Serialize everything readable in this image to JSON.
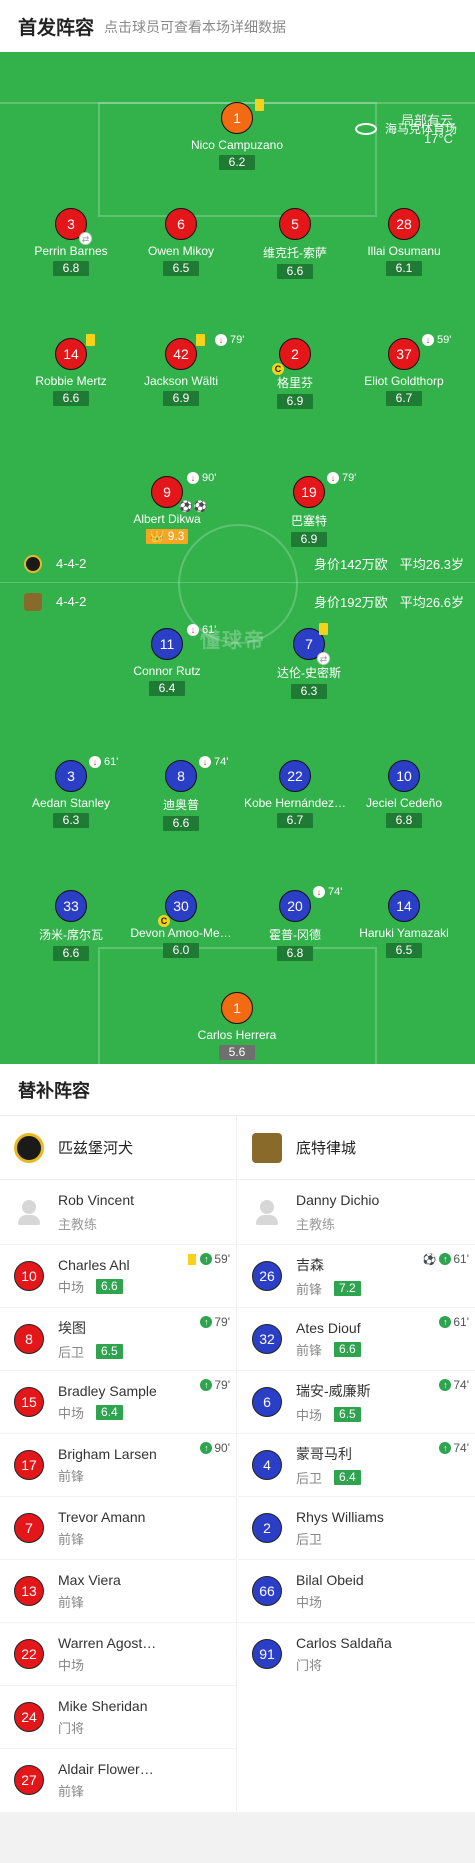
{
  "header": {
    "title": "首发阵容",
    "subtitle": "点击球员可查看本场详细数据"
  },
  "venue": {
    "name": "海马克体育场",
    "weather": "局部有云",
    "temp": "17°C"
  },
  "home_team": {
    "formation": "4-4-2",
    "value": "身价142万欧",
    "age": "平均26.3岁"
  },
  "away_team": {
    "formation": "4-4-2",
    "value": "身价192万欧",
    "age": "平均26.6岁"
  },
  "watermark": "懂球帝",
  "home_players": [
    {
      "num": "1",
      "name": "Nico Campuzano",
      "rating": "6.2"
    },
    {
      "num": "3",
      "name": "Perrin Barnes",
      "rating": "6.8"
    },
    {
      "num": "6",
      "name": "Owen Mikoy",
      "rating": "6.5"
    },
    {
      "num": "5",
      "name": "维克托-索萨",
      "rating": "6.6"
    },
    {
      "num": "28",
      "name": "Illai Osumanu",
      "rating": "6.1"
    },
    {
      "num": "14",
      "name": "Robbie Mertz",
      "rating": "6.6"
    },
    {
      "num": "42",
      "name": "Jackson Wälti",
      "rating": "6.9",
      "sub": "79'"
    },
    {
      "num": "2",
      "name": "格里芬",
      "rating": "6.9"
    },
    {
      "num": "37",
      "name": "Eliot Goldthorp",
      "rating": "6.7",
      "sub": "59'"
    },
    {
      "num": "9",
      "name": "Albert Dikwa",
      "rating": "9.3",
      "sub": "90'"
    },
    {
      "num": "19",
      "name": "巴塞特",
      "rating": "6.9",
      "sub": "79'"
    }
  ],
  "away_players": [
    {
      "num": "11",
      "name": "Connor Rutz",
      "rating": "6.4",
      "sub": "61'"
    },
    {
      "num": "7",
      "name": "达伦-史密斯",
      "rating": "6.3"
    },
    {
      "num": "3",
      "name": "Aedan Stanley",
      "rating": "6.3",
      "sub": "61'"
    },
    {
      "num": "8",
      "name": "迪奥普",
      "rating": "6.6",
      "sub": "74'"
    },
    {
      "num": "22",
      "name": "Kobe Hernández…",
      "rating": "6.7"
    },
    {
      "num": "10",
      "name": "Jeciel Cedeño",
      "rating": "6.8"
    },
    {
      "num": "33",
      "name": "汤米-席尔瓦",
      "rating": "6.6"
    },
    {
      "num": "30",
      "name": "Devon Amoo-Me…",
      "rating": "6.0"
    },
    {
      "num": "20",
      "name": "霍普-冈德",
      "rating": "6.8",
      "sub": "74'"
    },
    {
      "num": "14",
      "name": "Haruki Yamazaki",
      "rating": "6.5"
    },
    {
      "num": "1",
      "name": "Carlos Herrera",
      "rating": "5.6"
    }
  ],
  "subs": {
    "title": "替补阵容",
    "left": {
      "team": "匹兹堡河犬",
      "coach": {
        "name": "Rob Vincent",
        "role": "主教练"
      },
      "players": [
        {
          "num": "10",
          "name": "Charles Ahl",
          "pos": "中场",
          "rating": "6.6",
          "time": "59'"
        },
        {
          "num": "8",
          "name": "埃图",
          "pos": "后卫",
          "rating": "6.5",
          "time": "79'"
        },
        {
          "num": "15",
          "name": "Bradley Sample",
          "pos": "中场",
          "rating": "6.4",
          "time": "79'"
        },
        {
          "num": "17",
          "name": "Brigham Larsen",
          "pos": "前锋",
          "time": "90'"
        },
        {
          "num": "7",
          "name": "Trevor Amann",
          "pos": "前锋"
        },
        {
          "num": "13",
          "name": "Max Viera",
          "pos": "前锋"
        },
        {
          "num": "22",
          "name": "Warren Agost…",
          "pos": "中场"
        },
        {
          "num": "24",
          "name": "Mike Sheridan",
          "pos": "门将"
        },
        {
          "num": "27",
          "name": "Aldair Flower…",
          "pos": "前锋"
        }
      ]
    },
    "right": {
      "team": "底特律城",
      "coach": {
        "name": "Danny Dichio",
        "role": "主教练"
      },
      "players": [
        {
          "num": "26",
          "name": "吉森",
          "pos": "前锋",
          "rating": "7.2",
          "time": "61'"
        },
        {
          "num": "32",
          "name": "Ates Diouf",
          "pos": "前锋",
          "rating": "6.6",
          "time": "61'"
        },
        {
          "num": "6",
          "name": "瑞安-威廉斯",
          "pos": "中场",
          "rating": "6.5",
          "time": "74'"
        },
        {
          "num": "4",
          "name": "蒙哥马利",
          "pos": "后卫",
          "rating": "6.4",
          "time": "74'"
        },
        {
          "num": "2",
          "name": "Rhys Williams",
          "pos": "后卫"
        },
        {
          "num": "66",
          "name": "Bilal Obeid",
          "pos": "中场"
        },
        {
          "num": "91",
          "name": "Carlos Saldaña",
          "pos": "门将"
        }
      ]
    }
  },
  "colors": {
    "pitch": "#33b14b",
    "home": "#e3161a",
    "away": "#2a3ec6",
    "gk": "#f26a12",
    "rating": "#1f7a33"
  }
}
